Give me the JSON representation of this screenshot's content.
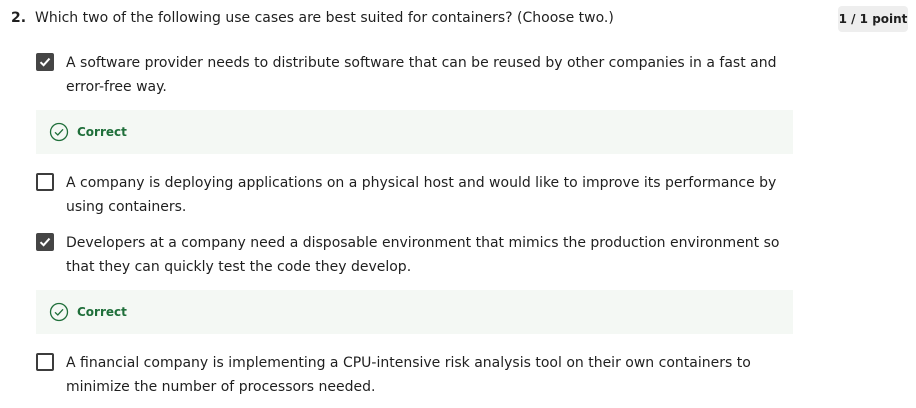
{
  "question": {
    "number": "2.",
    "text": "Which two of the following use cases are best suited for containers? (Choose two.)",
    "score": "1 / 1 point"
  },
  "options": [
    {
      "label": "A software provider needs to distribute software that can be reused by other companies in a fast and error-free way.",
      "checked": true,
      "feedback": "Correct"
    },
    {
      "label": "A company is deploying applications on a physical host and would like to improve its performance by using containers.",
      "checked": false
    },
    {
      "label": "Developers at a company need a disposable environment that mimics the production environment so that they can quickly test the code they develop.",
      "checked": true,
      "feedback": "Correct"
    },
    {
      "label": "A financial company is implementing a CPU-intensive risk analysis tool on their own containers to minimize the number of processors needed.",
      "checked": false
    }
  ],
  "icons": {
    "checkmark": "checkmark-icon",
    "correct": "check-circle-icon"
  },
  "colors": {
    "checked_box": "#454545",
    "correct_text": "#1f6f3a",
    "correct_bg": "#f4f8f4",
    "badge_bg": "#eeeeee"
  }
}
